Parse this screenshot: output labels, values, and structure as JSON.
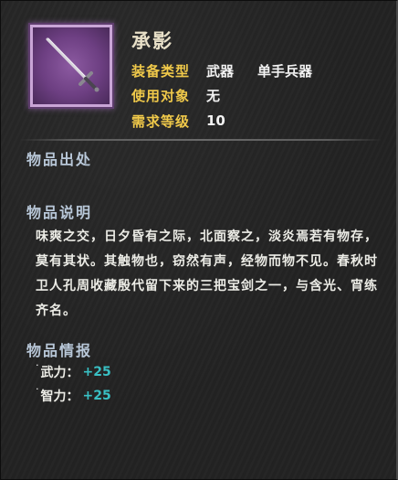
{
  "item": {
    "name": "承影",
    "icon": "sword-icon",
    "rarity_color": "#9b5fb5",
    "attributes": [
      {
        "label": "装备类型",
        "value": "武器",
        "value2": "单手兵器"
      },
      {
        "label": "使用对象",
        "value": "无"
      },
      {
        "label": "需求等级",
        "value": "10"
      }
    ]
  },
  "sections": {
    "source_title": "物品出处",
    "description_title": "物品说明",
    "description_text": "味爽之交，日夕昏有之际，北面察之，淡炎焉若有物存，莫有其状。其触物也，窃然有声，经物而物不见。春秋时卫人孔周收藏殷代留下来的三把宝剑之一，与含光、宵练齐名。",
    "info_title": "物品情报"
  },
  "stats": [
    {
      "bullet": "˙",
      "name": "武力：",
      "value": "+25"
    },
    {
      "bullet": "˙",
      "name": "智力：",
      "value": "+25"
    }
  ],
  "colors": {
    "label_gold": "#f0c94a",
    "stat_cyan": "#39c0c4",
    "section_blue": "#b8c7d8"
  }
}
